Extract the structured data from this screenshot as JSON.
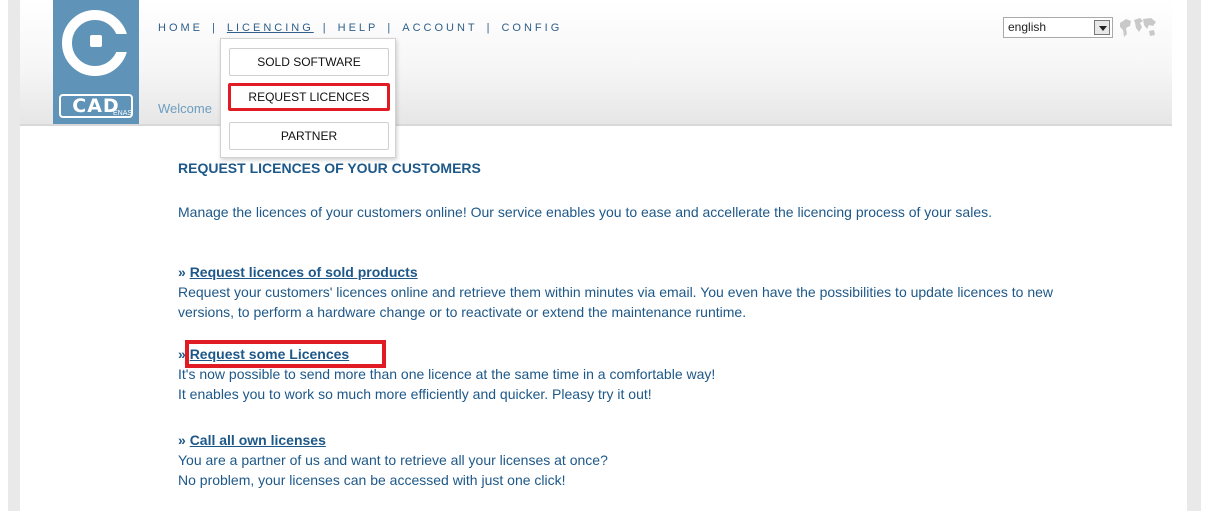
{
  "nav": {
    "items": [
      {
        "label": "HOME"
      },
      {
        "label": "LICENCING"
      },
      {
        "label": "HELP"
      },
      {
        "label": "ACCOUNT"
      },
      {
        "label": "CONFIG"
      }
    ],
    "separator": "|"
  },
  "dropdown": {
    "items": [
      {
        "label": "SOLD SOFTWARE"
      },
      {
        "label": "REQUEST LICENCES"
      },
      {
        "label": "PARTNER"
      }
    ]
  },
  "welcome": "Welcome",
  "logo": {
    "wordmark": "CAD",
    "sub": "ENAS"
  },
  "language": {
    "value": "english"
  },
  "content": {
    "title": "REQUEST LICENCES OF YOUR CUSTOMERS",
    "intro": "Manage the licences of your customers online! Our service enables you to ease and accellerate the licencing process of your sales.",
    "sections": [
      {
        "marker": "»",
        "link": "Request licences of sold products",
        "text": "Request your customers' licences online and retrieve them within minutes via email. You even have the possibilities to update licences to new versions, to perform a hardware change or to reactivate or extend the maintenance runtime."
      },
      {
        "marker": "»",
        "link": "Request some Licences",
        "text": "It's now possible to send more than one licence at the same time in a comfortable way!",
        "text2": "It enables you to work so much more efficiently and quicker. Pleasy try it out!"
      },
      {
        "marker": "»",
        "link": "Call all own licenses",
        "text": "You are a partner of us and want to retrieve all your licenses at once?",
        "text2": "No problem, your licenses can be accessed with just one click!"
      }
    ]
  },
  "colors": {
    "accent": "#1d5889",
    "highlight": "#e01b23",
    "logo": "#5f93b7"
  }
}
